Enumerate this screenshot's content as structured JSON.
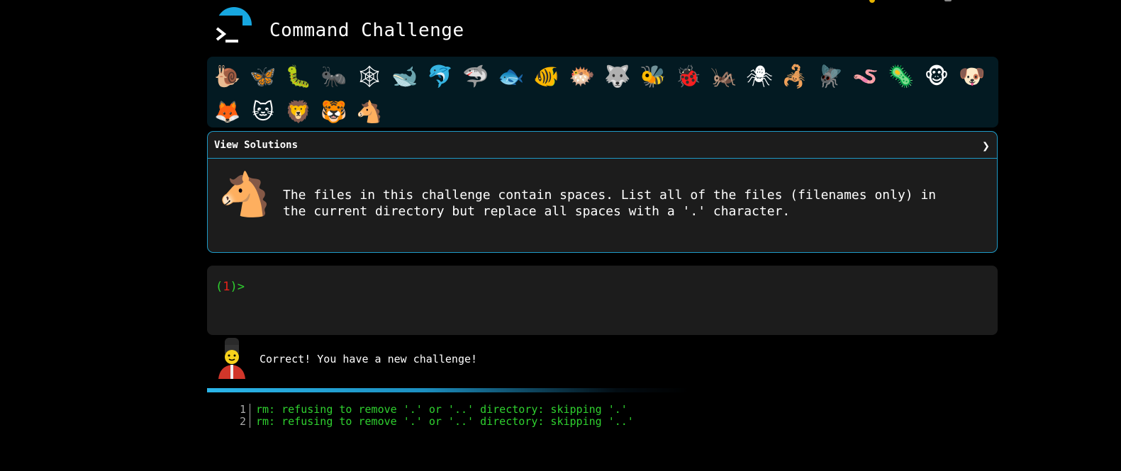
{
  "header": {
    "title": "Command Challenge"
  },
  "badges": [
    {
      "icon": "snail-icon",
      "glyph": "🐌"
    },
    {
      "icon": "butterfly-icon",
      "glyph": "🦋"
    },
    {
      "icon": "caterpillar-icon",
      "glyph": "🐛"
    },
    {
      "icon": "ant-icon",
      "glyph": "🐜"
    },
    {
      "icon": "spider-web-icon",
      "glyph": "🕸"
    },
    {
      "icon": "whale-icon",
      "glyph": "🐋"
    },
    {
      "icon": "dolphin-icon",
      "glyph": "🐬"
    },
    {
      "icon": "shark-icon",
      "glyph": "🦈"
    },
    {
      "icon": "fish-icon",
      "glyph": "🐟"
    },
    {
      "icon": "tropical-fish-icon",
      "glyph": "🐠"
    },
    {
      "icon": "blowfish-icon",
      "glyph": "🐡"
    },
    {
      "icon": "wolf-icon",
      "glyph": "🐺"
    },
    {
      "icon": "bee-icon",
      "glyph": "🐝"
    },
    {
      "icon": "ladybug-icon",
      "glyph": "🐞"
    },
    {
      "icon": "cricket-icon",
      "glyph": "🦗"
    },
    {
      "icon": "spider-icon",
      "glyph": "🕷"
    },
    {
      "icon": "scorpion-icon",
      "glyph": "🦂"
    },
    {
      "icon": "fly-icon",
      "glyph": "🪰"
    },
    {
      "icon": "worm-icon",
      "glyph": "🪱"
    },
    {
      "icon": "microbe-icon",
      "glyph": "🦠"
    },
    {
      "icon": "monkey-icon",
      "glyph": "🐵"
    },
    {
      "icon": "dog-icon",
      "glyph": "🐶"
    },
    {
      "icon": "fox-icon",
      "glyph": "🦊"
    },
    {
      "icon": "cat-icon",
      "glyph": "🐱"
    },
    {
      "icon": "lion-icon",
      "glyph": "🦁"
    },
    {
      "icon": "tiger-icon",
      "glyph": "🐯"
    },
    {
      "icon": "horse-icon",
      "glyph": "🐴"
    }
  ],
  "solutions": {
    "label": "View Solutions",
    "chevron": "❯"
  },
  "challenge": {
    "icon": "horse-icon",
    "glyph": "🐴",
    "text": "The files in this challenge contain spaces. List all of the files (filenames only) in the current directory but replace all spaces with a '.' character."
  },
  "terminal": {
    "open_paren": "(",
    "number": "1",
    "close_prompt": ")>"
  },
  "feedback": {
    "text": "Correct! You have a new challenge!"
  },
  "progress": {
    "fraction": 0.43
  },
  "output": [
    {
      "num": "1",
      "text": "rm: refusing to remove '.' or '..' directory: skipping '.'"
    },
    {
      "num": "2",
      "text": "rm: refusing to remove '.' or '..' directory: skipping '..'"
    }
  ],
  "colors": {
    "accent": "#1e9ac7",
    "prompt_green": "#2fd12f",
    "prompt_red": "#e8231a",
    "panel": "#1c1c1c",
    "badge_panel": "#031a22"
  }
}
